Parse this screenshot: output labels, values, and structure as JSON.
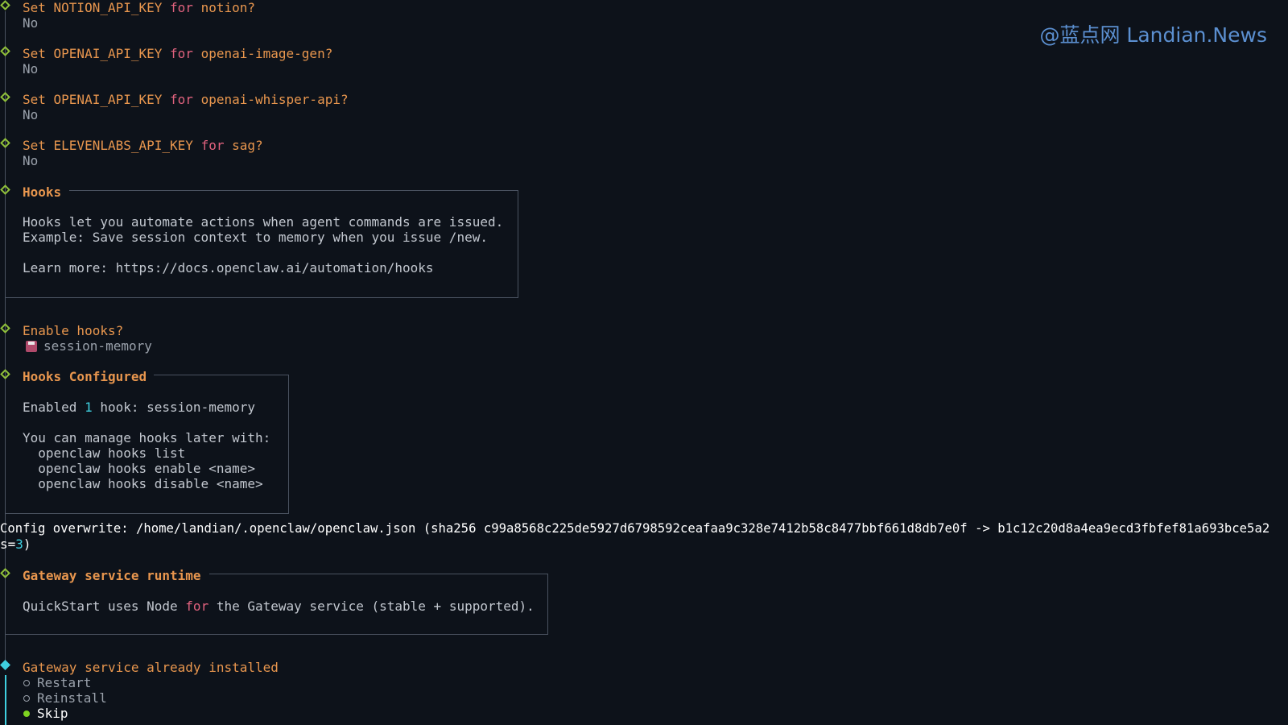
{
  "watermark": "@蓝点网 Landian.News",
  "prompts": [
    {
      "pre": "Set NOTION_API_KEY ",
      "kw": "for",
      "post": " notion?",
      "answer": "No"
    },
    {
      "pre": "Set OPENAI_API_KEY ",
      "kw": "for",
      "post": " openai-image-gen?",
      "answer": "No"
    },
    {
      "pre": "Set OPENAI_API_KEY ",
      "kw": "for",
      "post": " openai-whisper-api?",
      "answer": "No"
    },
    {
      "pre": "Set ELEVENLABS_API_KEY ",
      "kw": "for",
      "post": " sag?",
      "answer": "No"
    }
  ],
  "hooks_box": {
    "title": "Hooks",
    "line1": "Hooks let you automate actions when agent commands are issued.",
    "line2": "Example: Save session context to memory when you issue /new.",
    "line3": "Learn more: https://docs.openclaw.ai/automation/hooks"
  },
  "enable_hooks": {
    "question": "Enable hooks?",
    "answer": "session-memory"
  },
  "hooks_configured": {
    "title": "Hooks Configured",
    "enabled_pre": "Enabled ",
    "enabled_count": "1",
    "enabled_post": " hook: session-memory",
    "manage": "You can manage hooks later with:",
    "cmd1": "  openclaw hooks list",
    "cmd2": "  openclaw hooks enable <name>",
    "cmd3": "  openclaw hooks disable <name>"
  },
  "config_overwrite": {
    "line1": "Config overwrite: /home/landian/.openclaw/openclaw.json (sha256 c99a8568c225de5927d6798592ceafaa9c328e7412b58c8477bbf661d8db7e0f -> b1c12c20d8a4ea9ecd3fbfef81a693bce5a2",
    "line2_pre": "s=",
    "line2_num": "3",
    "line2_post": ")"
  },
  "gateway_runtime": {
    "title": "Gateway service runtime",
    "pre": "QuickStart uses Node ",
    "kw": "for",
    "post": " the Gateway service (stable + supported)."
  },
  "gateway_installed": {
    "question": "Gateway service already installed",
    "options": [
      "Restart",
      "Reinstall",
      "Skip"
    ],
    "selected": "Skip"
  }
}
